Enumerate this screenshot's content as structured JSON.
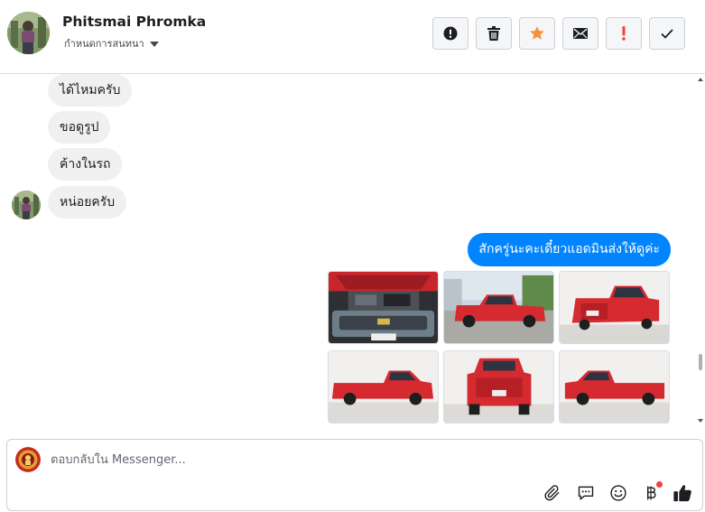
{
  "header": {
    "contact_name": "Phitsmai Phromka",
    "subtitle": "กำหนดการสนทนา",
    "actions": [
      {
        "name": "info-icon"
      },
      {
        "name": "trash-icon"
      },
      {
        "name": "star-icon",
        "color": "#f7923b"
      },
      {
        "name": "envelope-icon"
      },
      {
        "name": "exclamation-icon",
        "color": "#fa3e3e"
      },
      {
        "name": "check-icon"
      }
    ]
  },
  "thread": {
    "incoming": [
      {
        "text": "ได้ไหมครับ"
      },
      {
        "text": "ขอดูรูป"
      },
      {
        "text": "ค้างในรถ"
      },
      {
        "text": "หน่อยครับ"
      }
    ],
    "outgoing_text": "สักครู่นะคะเดี๋ยวแอดมินส่งให้ดูค่ะ",
    "outgoing_color": "#0084ff",
    "photos": [
      {
        "name": "photo-engine-bay"
      },
      {
        "name": "photo-front-left"
      },
      {
        "name": "photo-rear-right"
      },
      {
        "name": "photo-left-side"
      },
      {
        "name": "photo-rear"
      },
      {
        "name": "photo-right-side"
      }
    ]
  },
  "composer": {
    "placeholder": "ตอบกลับใน Messenger...",
    "tools": [
      "paperclip-icon",
      "saved-reply-icon",
      "emoji-icon",
      "baht-payment-icon",
      "thumbs-up-icon"
    ]
  }
}
